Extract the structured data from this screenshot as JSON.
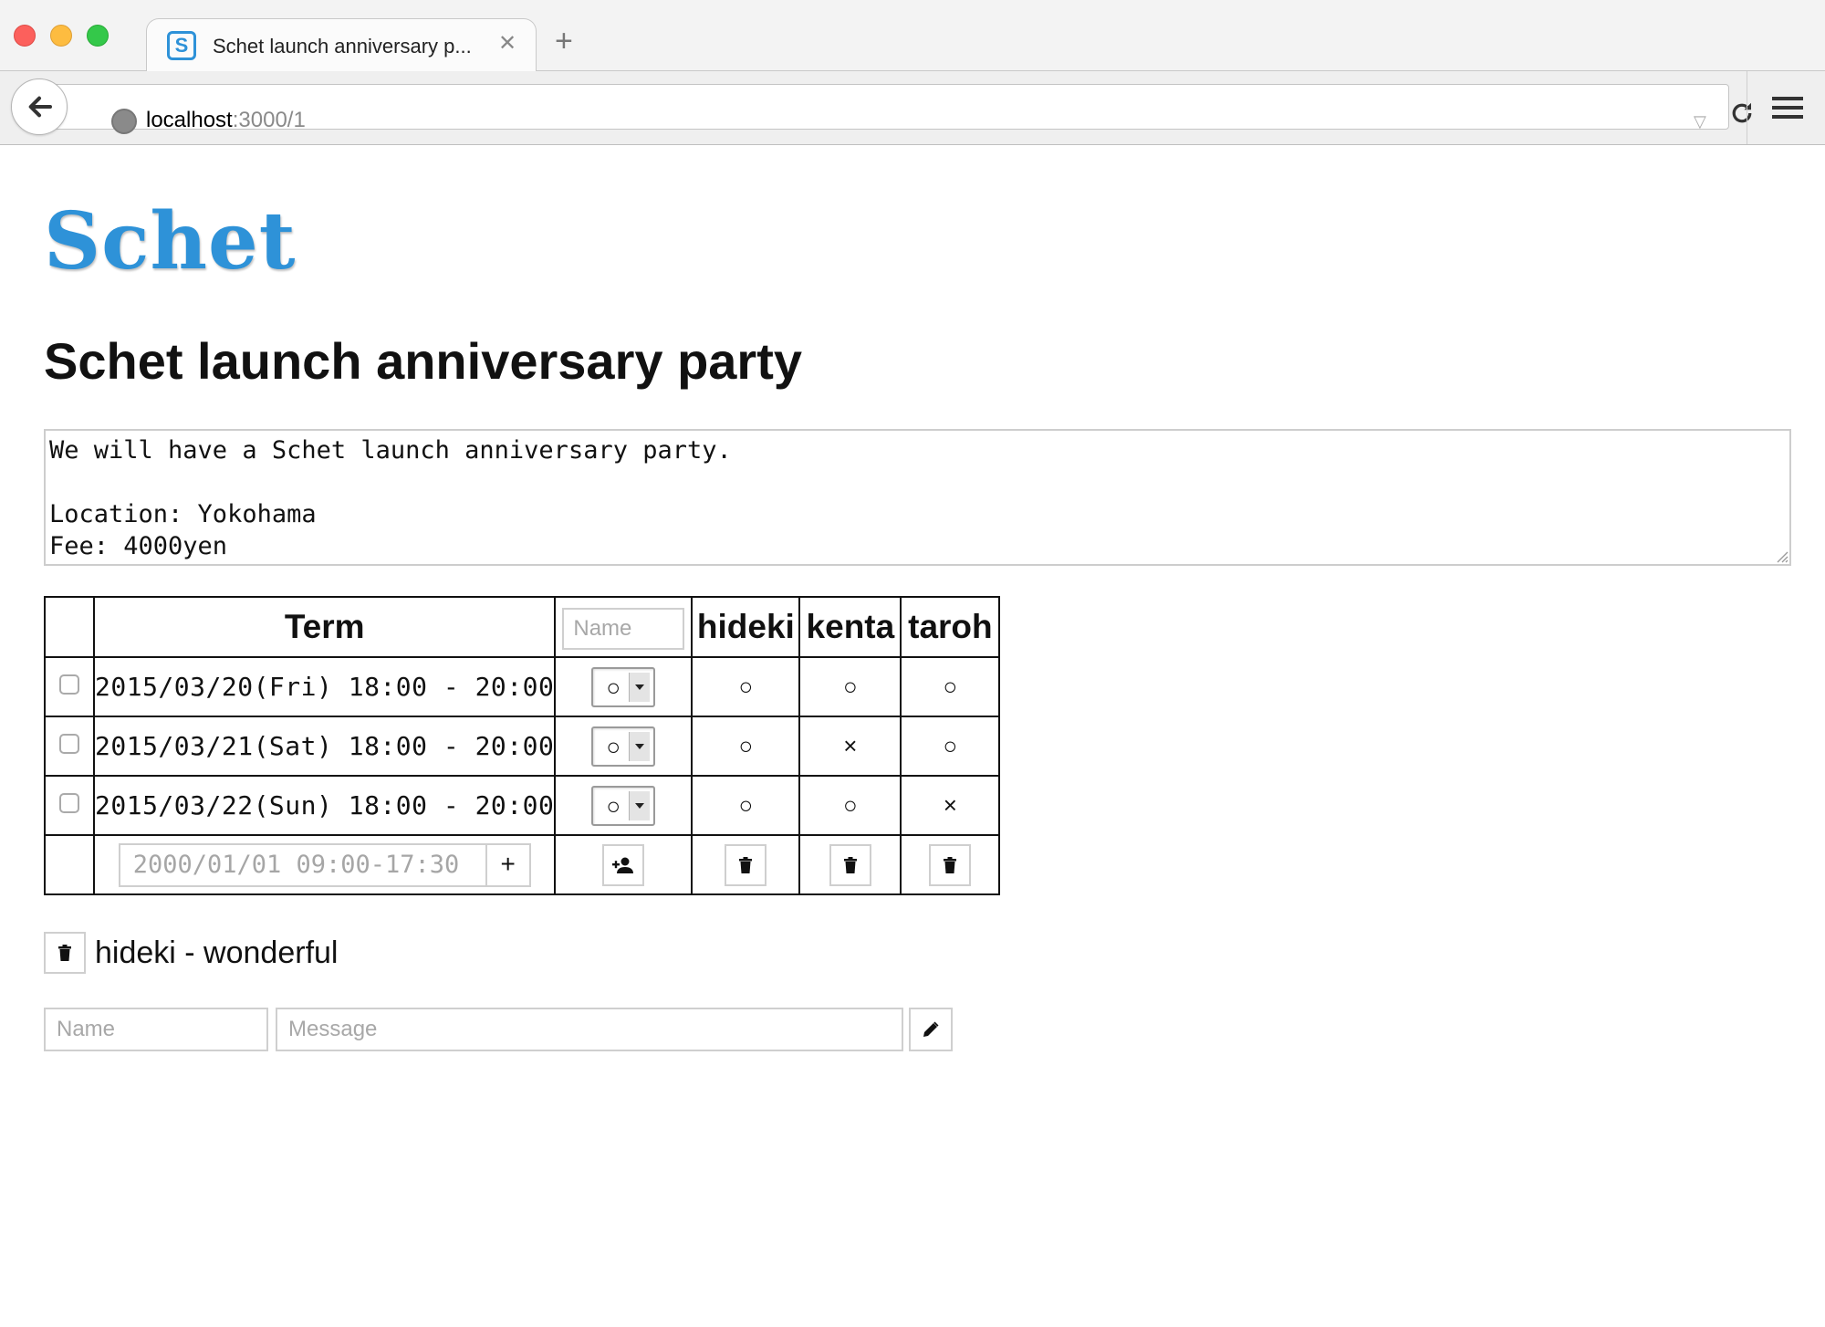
{
  "browser": {
    "tab_title": "Schet launch anniversary p...",
    "tab_favicon_letter": "S",
    "url_host": "localhost",
    "url_rest": ":3000/1"
  },
  "page": {
    "logo": "Schet",
    "event_title": "Schet launch anniversary party",
    "description": "We will have a Schet launch anniversary party.\n\nLocation: Yokohama\nFee: 4000yen"
  },
  "schedule": {
    "term_header": "Term",
    "name_placeholder": "Name",
    "participants": [
      "hideki",
      "kenta",
      "taroh"
    ],
    "rows": [
      {
        "term": "2015/03/20(Fri) 18:00 - 20:00",
        "selected": "○",
        "answers": [
          "○",
          "○",
          "○"
        ]
      },
      {
        "term": "2015/03/21(Sat) 18:00 - 20:00",
        "selected": "○",
        "answers": [
          "○",
          "×",
          "○"
        ]
      },
      {
        "term": "2015/03/22(Sun) 18:00 - 20:00",
        "selected": "○",
        "answers": [
          "○",
          "○",
          "×"
        ]
      }
    ],
    "new_term_placeholder": "2000/01/01 09:00-17:30",
    "add_term_label": "+"
  },
  "comments": [
    {
      "text": "hideki - wonderful"
    }
  ],
  "new_comment": {
    "name_placeholder": "Name",
    "message_placeholder": "Message"
  },
  "colors": {
    "accent": "#2e92d8"
  },
  "icons": [
    "back-icon",
    "globe-icon",
    "reload-icon",
    "hamburger-menu-icon",
    "add-user-icon",
    "trash-icon",
    "pencil-icon",
    "close-icon",
    "plus-icon"
  ]
}
